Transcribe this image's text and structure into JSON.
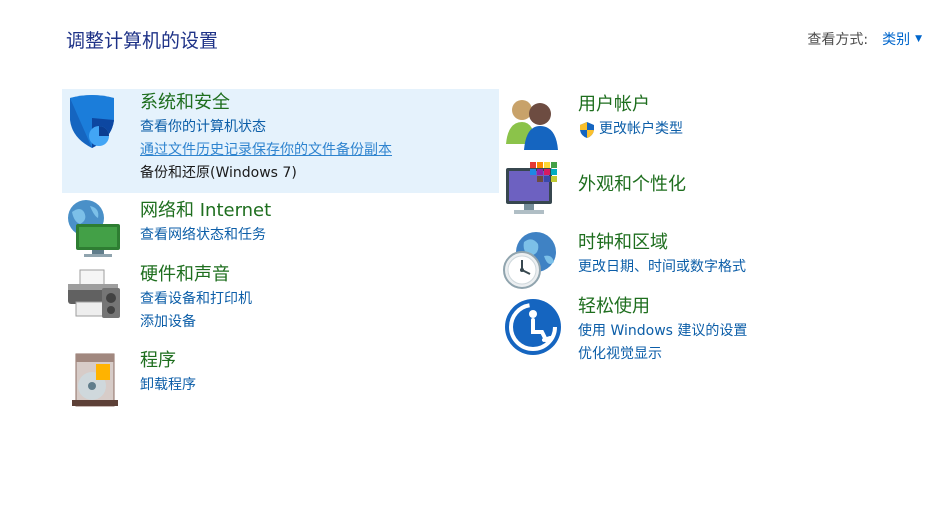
{
  "header": {
    "title": "调整计算机的设置",
    "view_by_label": "查看方式:",
    "view_by_value": "类别"
  },
  "left": [
    {
      "title": "系统和安全",
      "icon": "shield-icon",
      "links": [
        "查看你的计算机状态",
        "通过文件历史记录保存你的文件备份副本",
        "备份和还原(Windows 7)"
      ]
    },
    {
      "title": "网络和 Internet",
      "icon": "network-globe-icon",
      "links": [
        "查看网络状态和任务"
      ]
    },
    {
      "title": "硬件和声音",
      "icon": "printer-icon",
      "links": [
        "查看设备和打印机",
        "添加设备"
      ]
    },
    {
      "title": "程序",
      "icon": "programs-disc-icon",
      "links": [
        "卸载程序"
      ]
    }
  ],
  "right": [
    {
      "title": "用户帐户",
      "icon": "users-icon",
      "links": [
        "更改帐户类型"
      ]
    },
    {
      "title": "外观和个性化",
      "icon": "monitor-palette-icon",
      "links": []
    },
    {
      "title": "时钟和区域",
      "icon": "clock-globe-icon",
      "links": [
        "更改日期、时间或数字格式"
      ]
    },
    {
      "title": "轻松使用",
      "icon": "ease-of-access-icon",
      "links": [
        "使用 Windows 建议的设置",
        "优化视觉显示"
      ]
    }
  ],
  "colors": {
    "title_green": "#1e6e1e",
    "link_blue": "#0c5ea8",
    "header_blue": "#1e3287",
    "highlight": "#e5f2fc"
  }
}
